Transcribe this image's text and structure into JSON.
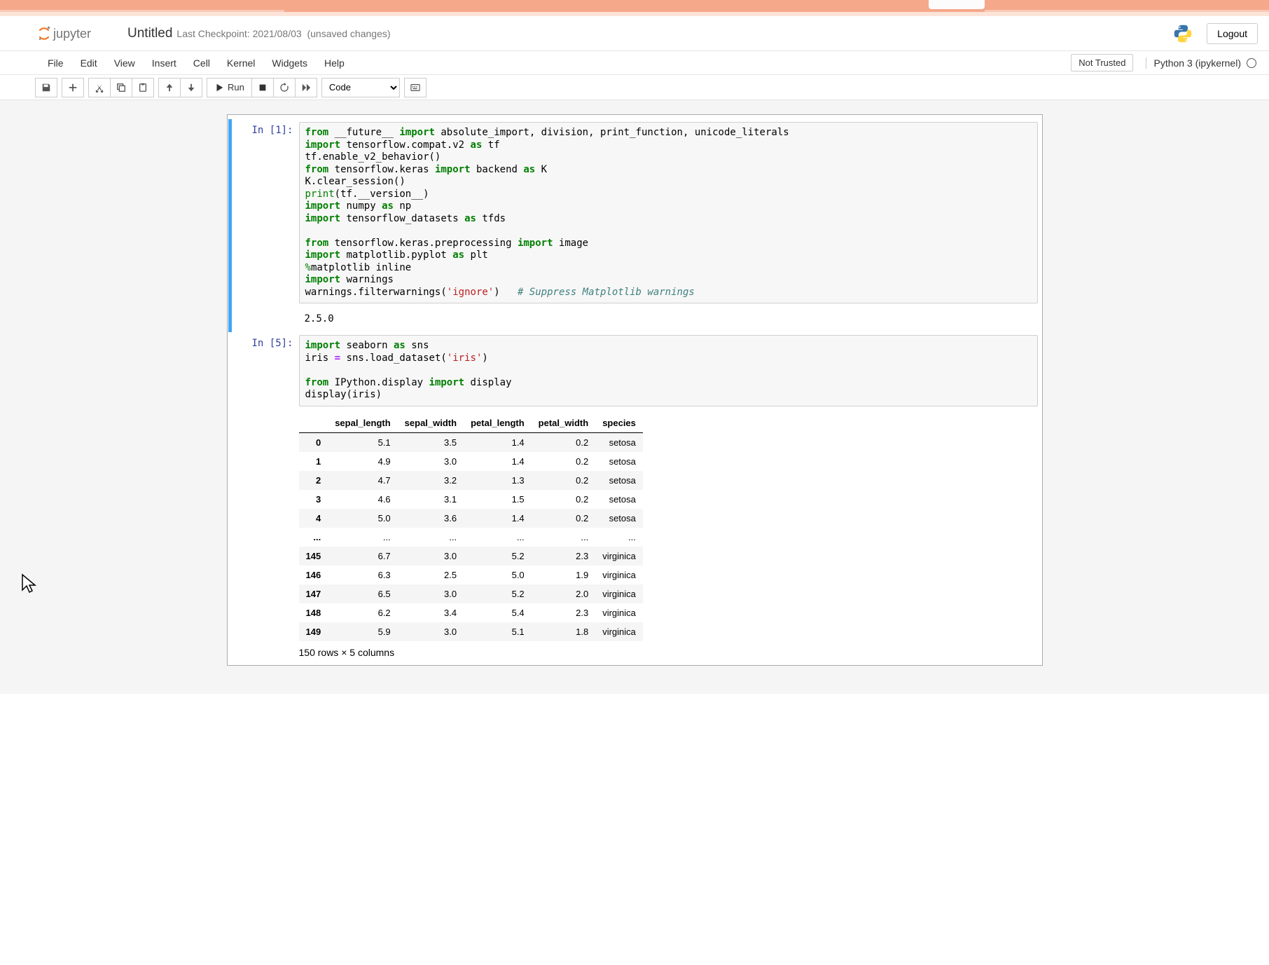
{
  "header": {
    "title": "Untitled",
    "checkpoint": "Last Checkpoint: 2021/08/03",
    "unsaved": "(unsaved changes)",
    "logout": "Logout"
  },
  "menu": {
    "items": [
      "File",
      "Edit",
      "View",
      "Insert",
      "Cell",
      "Kernel",
      "Widgets",
      "Help"
    ],
    "not_trusted": "Not Trusted",
    "kernel": "Python 3 (ipykernel)"
  },
  "toolbar": {
    "run": "Run",
    "cell_type": "Code"
  },
  "cells": [
    {
      "prompt": "In [1]:",
      "output": "2.5.0"
    },
    {
      "prompt": "In [5]:"
    }
  ],
  "dataframe": {
    "columns": [
      "",
      "sepal_length",
      "sepal_width",
      "petal_length",
      "petal_width",
      "species"
    ],
    "rows": [
      [
        "0",
        "5.1",
        "3.5",
        "1.4",
        "0.2",
        "setosa"
      ],
      [
        "1",
        "4.9",
        "3.0",
        "1.4",
        "0.2",
        "setosa"
      ],
      [
        "2",
        "4.7",
        "3.2",
        "1.3",
        "0.2",
        "setosa"
      ],
      [
        "3",
        "4.6",
        "3.1",
        "1.5",
        "0.2",
        "setosa"
      ],
      [
        "4",
        "5.0",
        "3.6",
        "1.4",
        "0.2",
        "setosa"
      ],
      [
        "...",
        "...",
        "...",
        "...",
        "...",
        "..."
      ],
      [
        "145",
        "6.7",
        "3.0",
        "5.2",
        "2.3",
        "virginica"
      ],
      [
        "146",
        "6.3",
        "2.5",
        "5.0",
        "1.9",
        "virginica"
      ],
      [
        "147",
        "6.5",
        "3.0",
        "5.2",
        "2.0",
        "virginica"
      ],
      [
        "148",
        "6.2",
        "3.4",
        "5.4",
        "2.3",
        "virginica"
      ],
      [
        "149",
        "5.9",
        "3.0",
        "5.1",
        "1.8",
        "virginica"
      ]
    ],
    "caption": "150 rows × 5 columns"
  }
}
